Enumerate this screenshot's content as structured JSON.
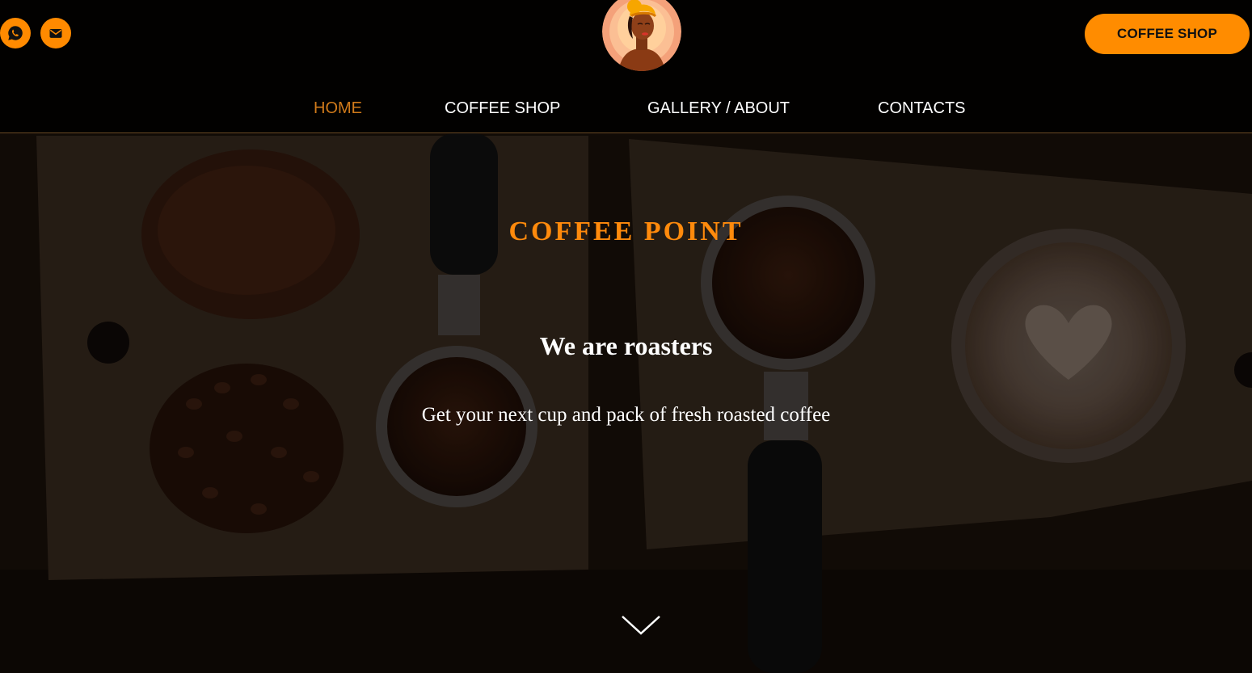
{
  "header": {
    "social": [
      {
        "icon": "whatsapp-icon"
      },
      {
        "icon": "mail-icon"
      }
    ],
    "cta_label": "COFFEE SHOP",
    "nav": [
      {
        "label": "HOME",
        "active": true
      },
      {
        "label": "COFFEE SHOP",
        "active": false
      },
      {
        "label": "GALLERY / ABOUT",
        "active": false
      },
      {
        "label": "CONTACTS",
        "active": false
      }
    ]
  },
  "hero": {
    "title": "COFFEE POINT",
    "subtitle": "We are roasters",
    "text": "Get your next cup and pack of fresh roasted coffee",
    "scroll_icon": "chevron-down-icon"
  },
  "colors": {
    "accent": "#ff8a00",
    "nav_active": "#d07a1a",
    "header_bg": "#020100"
  }
}
